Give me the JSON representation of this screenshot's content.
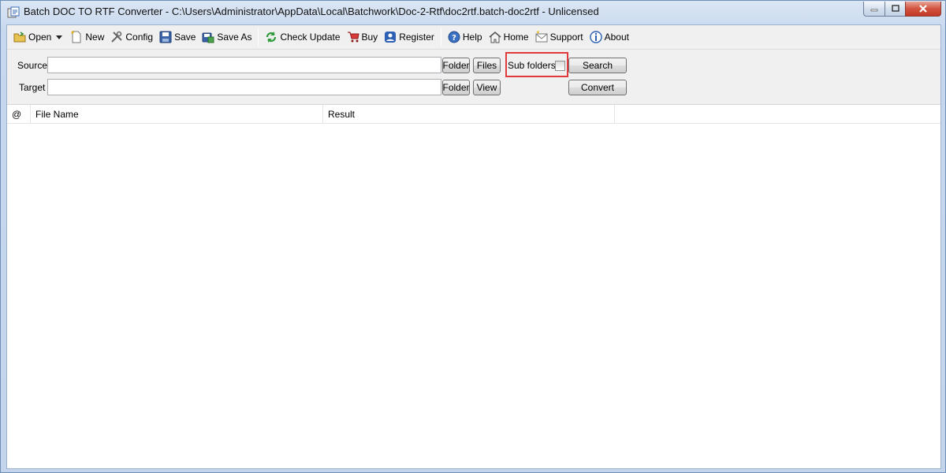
{
  "window": {
    "title": "Batch DOC TO RTF Converter - C:\\Users\\Administrator\\AppData\\Local\\Batchwork\\Doc-2-Rtf\\doc2rtf.batch-doc2rtf - Unlicensed"
  },
  "toolbar": {
    "open": "Open",
    "new": "New",
    "config": "Config",
    "save": "Save",
    "save_as": "Save As",
    "check_update": "Check Update",
    "buy": "Buy",
    "register": "Register",
    "help": "Help",
    "home": "Home",
    "support": "Support",
    "about": "About"
  },
  "form": {
    "source_label": "Source",
    "source_value": "",
    "target_label": "Target",
    "target_value": "",
    "folder_button": "Folder",
    "files_button": "Files",
    "view_button": "View",
    "subfolders_label": "Sub folders",
    "subfolders_checked": false,
    "search_button": "Search",
    "convert_button": "Convert"
  },
  "list": {
    "columns": [
      "@",
      "File Name",
      "Result"
    ],
    "rows": []
  },
  "colors": {
    "highlight_box": "#e23b3b",
    "title_gradient": "#c6d7ee"
  }
}
